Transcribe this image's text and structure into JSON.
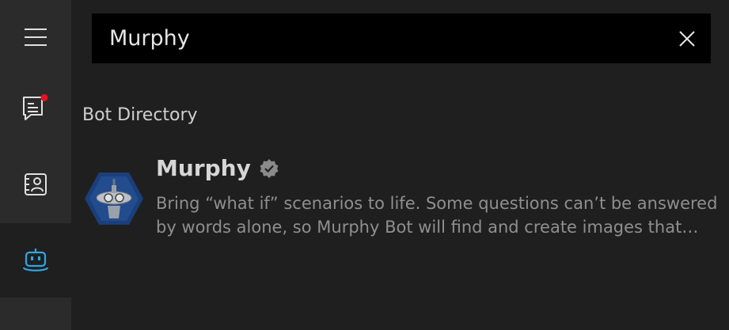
{
  "sidebar": {
    "items": [
      {
        "id": "menu",
        "icon": "hamburger-menu-icon"
      },
      {
        "id": "chats",
        "icon": "chat-icon",
        "notification": true
      },
      {
        "id": "contacts",
        "icon": "contacts-icon"
      },
      {
        "id": "bots",
        "icon": "bot-icon",
        "active": true
      }
    ],
    "accent": "#2ea6e6",
    "notification_color": "#e81123"
  },
  "search": {
    "value": "Murphy",
    "clear_icon": "close-icon"
  },
  "section": {
    "title": "Bot Directory"
  },
  "results": [
    {
      "name": "Murphy",
      "verified": true,
      "description": "Bring “what if” scenarios to life. Some questions can’t be answered by words alone, so Murphy Bot will find and create images that illustrate them."
    }
  ]
}
